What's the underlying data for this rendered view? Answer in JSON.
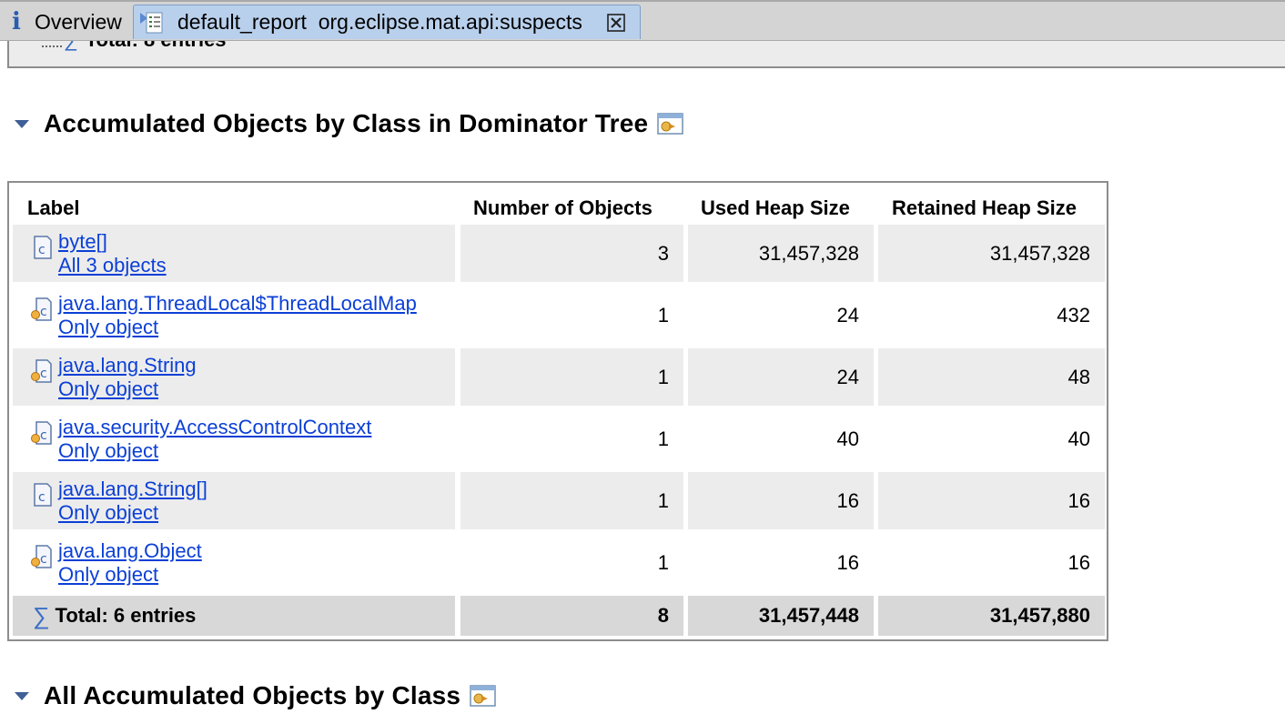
{
  "tabs": {
    "overview_label": "Overview",
    "report_label": "default_report  org.eclipse.mat.api:suspects"
  },
  "previous_table": {
    "total_label": "Total: 8 entries"
  },
  "section1": {
    "title": "Accumulated Objects by Class in Dominator Tree"
  },
  "table": {
    "headers": [
      "Label",
      "Number of Objects",
      "Used Heap Size",
      "Retained Heap Size"
    ],
    "rows": [
      {
        "class_name": "byte[]",
        "objects_link": "All 3 objects",
        "icon": "class-icon",
        "count": "3",
        "used": "31,457,328",
        "retained": "31,457,328"
      },
      {
        "class_name": "java.lang.ThreadLocal$ThreadLocalMap",
        "objects_link": "Only object",
        "icon": "class-instance-icon",
        "count": "1",
        "used": "24",
        "retained": "432"
      },
      {
        "class_name": "java.lang.String",
        "objects_link": "Only object",
        "icon": "class-instance-icon",
        "count": "1",
        "used": "24",
        "retained": "48"
      },
      {
        "class_name": "java.security.AccessControlContext",
        "objects_link": "Only object",
        "icon": "class-instance-icon",
        "count": "1",
        "used": "40",
        "retained": "40"
      },
      {
        "class_name": "java.lang.String[]",
        "objects_link": "Only object",
        "icon": "class-icon",
        "count": "1",
        "used": "16",
        "retained": "16"
      },
      {
        "class_name": "java.lang.Object",
        "objects_link": "Only object",
        "icon": "class-instance-icon",
        "count": "1",
        "used": "16",
        "retained": "16"
      }
    ],
    "total": {
      "label": "Total: 6 entries",
      "count": "8",
      "used": "31,457,448",
      "retained": "31,457,880"
    }
  },
  "section2": {
    "title": "All Accumulated Objects by Class"
  },
  "colors": {
    "link": "#0b3fd6",
    "row_shade": "#ececec",
    "total_shade": "#d8d8d8",
    "active_tab": "#b9d0ec"
  }
}
